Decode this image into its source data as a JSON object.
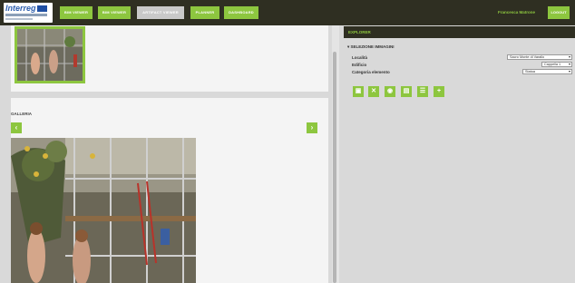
{
  "header": {
    "logo_text": "Interreg",
    "nav": [
      {
        "label": "BIM VIEWER"
      },
      {
        "label": "BIM VIEWER"
      },
      {
        "label": "ARTIFACT VIEWER"
      },
      {
        "label": "PLANNER"
      },
      {
        "label": "DASHBOARD"
      }
    ],
    "active_index": 2,
    "user_name": "Francesca Matrone",
    "logout_label": "LOGOUT"
  },
  "gallery": {
    "label": "GALLERIA",
    "prev_glyph": "‹",
    "next_glyph": "›"
  },
  "explorer": {
    "title": "EXPLORER",
    "section_title": "SELEZIONE IMMAGINI",
    "fields": [
      {
        "label": "Località",
        "value": "Sacro Monte di Varallo"
      },
      {
        "label": "Edificio",
        "value": "Cappella 1"
      },
      {
        "label": "Categoria elemento",
        "value": "Statua"
      }
    ],
    "tools": [
      {
        "icon": "image-icon",
        "glyph": "▣"
      },
      {
        "icon": "close-icon",
        "glyph": "✕"
      },
      {
        "icon": "camera-icon",
        "glyph": "◉"
      },
      {
        "icon": "document-icon",
        "glyph": "▤"
      },
      {
        "icon": "list-icon",
        "glyph": "☰"
      },
      {
        "icon": "add-icon",
        "glyph": "+"
      }
    ]
  },
  "colors": {
    "accent": "#8dc63f",
    "topbar": "#2f2f22",
    "active_nav": "#c9c9c9"
  }
}
